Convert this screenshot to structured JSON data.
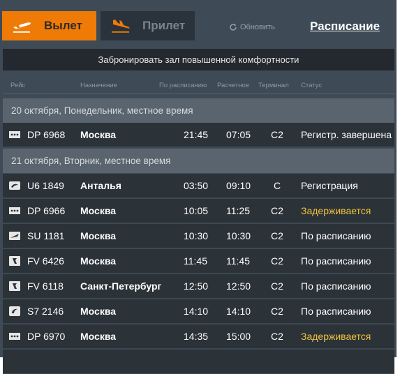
{
  "tabs": {
    "departures": {
      "label": "Вылет",
      "icon": "plane-takeoff-icon",
      "active": true,
      "color": "#ef7a06"
    },
    "arrivals": {
      "label": "Прилет",
      "icon": "plane-landing-icon",
      "active": false
    }
  },
  "refresh_label": "Обновить",
  "schedule_link": "Расписание",
  "lounge_banner": "Забронировать зал повышенной комфортности",
  "columns": {
    "flight": "Рейс",
    "destination": "Назначение",
    "scheduled": "По расписанию",
    "estimated": "Расчетное",
    "terminal": "Терминал",
    "status": "Статус"
  },
  "days": [
    {
      "header": "20 октября, Понедельник, местное время",
      "flights": [
        {
          "logo": "airline-logo-dp-icon",
          "flight": "DP 6968",
          "destination": "Москва",
          "scheduled": "21:45",
          "estimated": "07:05",
          "terminal": "C2",
          "status": "Регистр. завершена",
          "status_type": "normal"
        }
      ]
    },
    {
      "header": "21 октября, Вторник, местное время",
      "flights": [
        {
          "logo": "airline-logo-u6-icon",
          "flight": "U6 1849",
          "destination": "Анталья",
          "scheduled": "03:50",
          "estimated": "09:10",
          "terminal": "C",
          "status": "Регистрация",
          "status_type": "normal"
        },
        {
          "logo": "airline-logo-dp-icon",
          "flight": "DP 6966",
          "destination": "Москва",
          "scheduled": "10:05",
          "estimated": "11:25",
          "terminal": "C2",
          "status": "Задерживается",
          "status_type": "delayed"
        },
        {
          "logo": "airline-logo-su-icon",
          "flight": "SU 1181",
          "destination": "Москва",
          "scheduled": "10:30",
          "estimated": "10:30",
          "terminal": "C2",
          "status": "По расписанию",
          "status_type": "normal"
        },
        {
          "logo": "airline-logo-fv-icon",
          "flight": "FV 6426",
          "destination": "Москва",
          "scheduled": "11:45",
          "estimated": "11:45",
          "terminal": "C2",
          "status": "По расписанию",
          "status_type": "normal"
        },
        {
          "logo": "airline-logo-fv-icon",
          "flight": "FV 6118",
          "destination": "Санкт-Петербург",
          "scheduled": "12:50",
          "estimated": "12:50",
          "terminal": "C2",
          "status": "По расписанию",
          "status_type": "normal"
        },
        {
          "logo": "airline-logo-s7-icon",
          "flight": "S7 2146",
          "destination": "Москва",
          "scheduled": "14:10",
          "estimated": "14:10",
          "terminal": "C2",
          "status": "По расписанию",
          "status_type": "normal"
        },
        {
          "logo": "airline-logo-dp-icon",
          "flight": "DP 6970",
          "destination": "Москва",
          "scheduled": "14:35",
          "estimated": "15:00",
          "terminal": "C2",
          "status": "Задерживается",
          "status_type": "delayed"
        }
      ]
    }
  ],
  "colors": {
    "board_bg": "#3e4a55",
    "row_bg": "#2b3238",
    "day_bg": "#59646e",
    "delayed": "#f0c33c"
  }
}
